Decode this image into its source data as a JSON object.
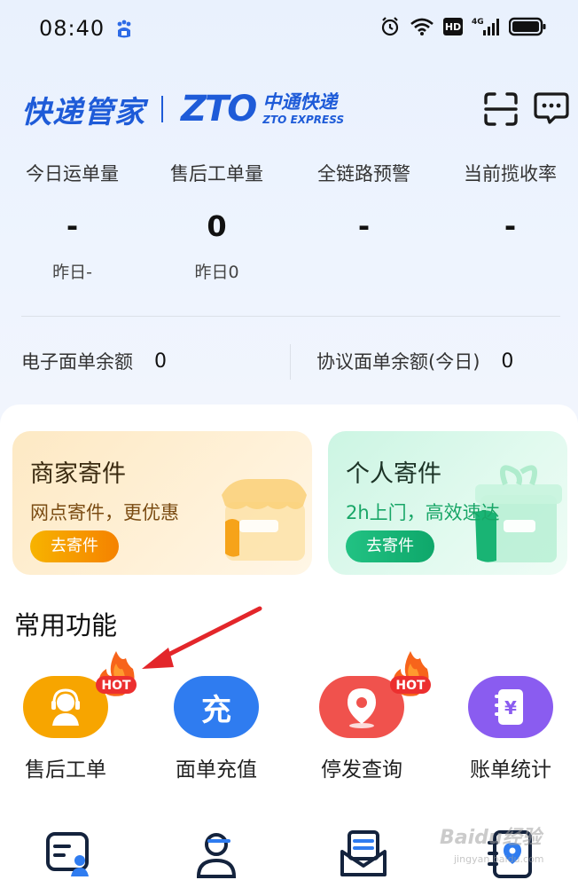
{
  "status_bar": {
    "time": "08:40",
    "icons": [
      "baidu-app-icon",
      "alarm-icon",
      "wifi-icon",
      "hd-icon",
      "signal-4g-icon",
      "battery-icon"
    ],
    "hd_label": "HD",
    "network_label": "4G"
  },
  "header": {
    "app_name": "快递管家",
    "company_logo_text": "ZTO",
    "company_cn": "中通快递",
    "company_en": "ZTO EXPRESS"
  },
  "stats": [
    {
      "label": "今日运单量",
      "value": "-",
      "sub": "昨日-"
    },
    {
      "label": "售后工单量",
      "value": "0",
      "sub": "昨日0"
    },
    {
      "label": "全链路预警",
      "value": "-",
      "sub": ""
    },
    {
      "label": "当前揽收率",
      "value": "-",
      "sub": ""
    }
  ],
  "balances": {
    "electronic_label": "电子面单余额",
    "electronic_value": "0",
    "agreement_label": "协议面单余额(今日)",
    "agreement_value": "0"
  },
  "promos": {
    "merchant": {
      "title": "商家寄件",
      "desc": "网点寄件，更优惠",
      "button": "去寄件"
    },
    "personal": {
      "title": "个人寄件",
      "desc": "2h上门，高效速达",
      "button": "去寄件"
    }
  },
  "section_title": "常用功能",
  "functions": [
    {
      "label": "售后工单",
      "hot": true,
      "icon": "customer-service-icon",
      "color": "#f7a500"
    },
    {
      "label": "面单充值",
      "hot": false,
      "icon": "recharge-icon",
      "glyph": "充",
      "color": "#2f7cf0"
    },
    {
      "label": "停发查询",
      "hot": true,
      "icon": "location-pin-icon",
      "color": "#f0524d"
    },
    {
      "label": "账单统计",
      "hot": false,
      "icon": "bill-yen-icon",
      "glyph": "¥",
      "color": "#8a5cf0"
    }
  ],
  "hot_badge": "HOT",
  "bottom_icons": [
    "document-user-icon",
    "user-edit-icon",
    "mail-inbox-icon",
    "location-notebook-icon"
  ],
  "watermark": {
    "text": "Baidu经验",
    "sub": "jingyan.baidu.com"
  }
}
